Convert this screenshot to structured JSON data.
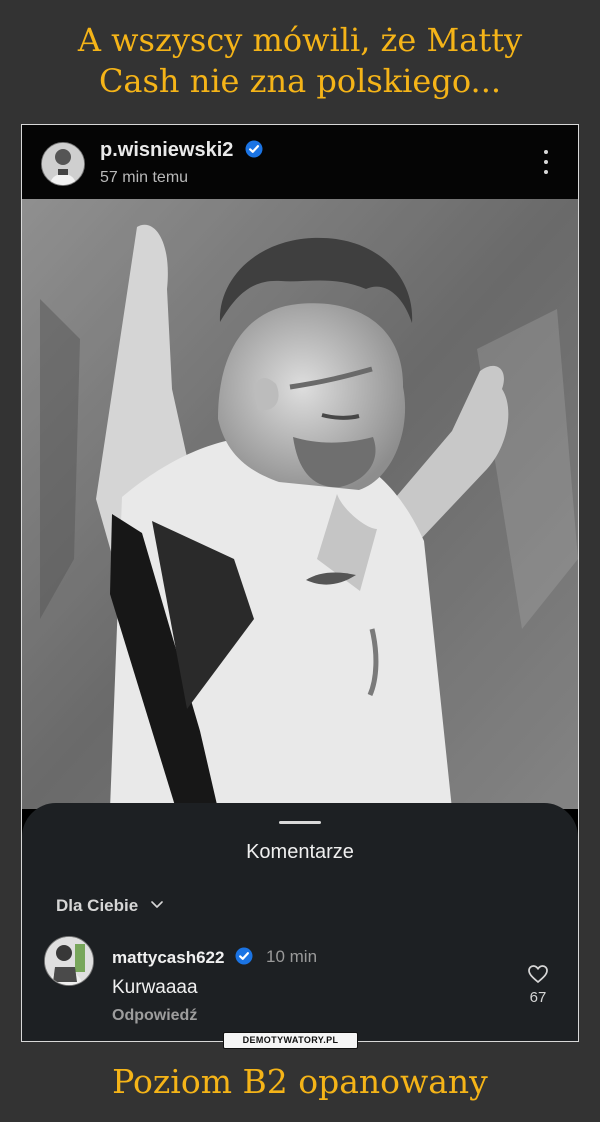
{
  "meme": {
    "title_line1": "A wszyscy mówili, że Matty",
    "title_line2": "Cash nie zna polskiego...",
    "caption": "Poziom B2 opanowany",
    "watermark": "DEMOTYWATORY.PL"
  },
  "post": {
    "username": "p.wisniewski2",
    "timestamp": "57 min temu",
    "avatar_icon": "profile-avatar-icon",
    "verified_icon": "verified-badge-icon",
    "more_icon": "vertical-dots-icon"
  },
  "comments": {
    "title": "Komentarze",
    "sort_label": "Dla Ciebie",
    "items": [
      {
        "username": "mattycash622",
        "time": "10 min",
        "text": "Kurwaaaa",
        "reply_label": "Odpowiedź",
        "likes": "67"
      }
    ]
  },
  "colors": {
    "accent": "#f5b418",
    "background": "#333333",
    "sheet": "#1d2023",
    "verified": "#1b74e4"
  }
}
